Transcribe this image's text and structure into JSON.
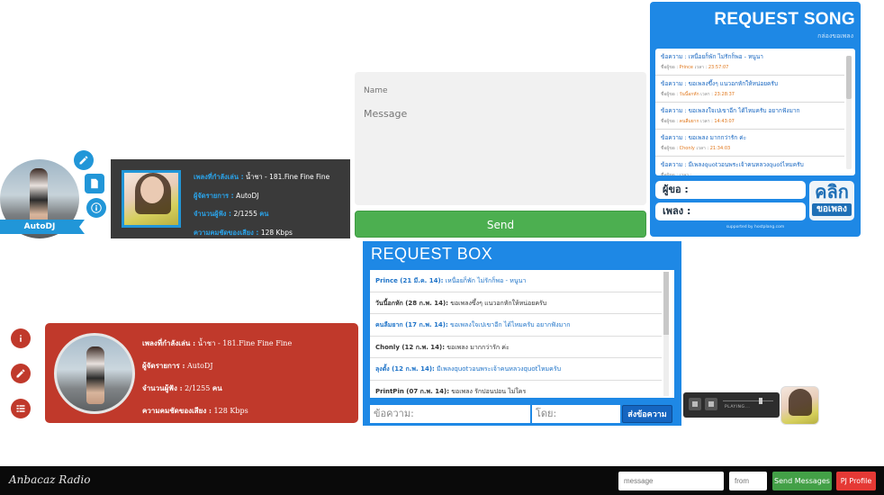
{
  "profile1": {
    "dj_name": "AutoDJ",
    "now_playing_label": "เพลงที่กำลังเล่น :",
    "now_playing_value": "น้ำชา - 181.Fine Fine Fine",
    "manager_label": "ผู้จัดรายการ :",
    "manager_value": "AutoDJ",
    "listeners_label": "จำนวนผู้ฟัง :",
    "listeners_value": "2/1255",
    "listeners_unit": "คน",
    "bitrate_label": "ความคมชัดของเสียง :",
    "bitrate_value": "128 Kbps"
  },
  "form": {
    "name_placeholder": "Name",
    "message_placeholder": "Message",
    "send_label": "Send"
  },
  "request_song": {
    "title": "REQUEST SONG",
    "subtitle": "กล่องขอเพลง",
    "name_prefix": "ชื่อผู้ขอ :",
    "time_prefix": "เวลา :",
    "items": [
      {
        "message": "ข้อความ : เหนื่อยก็พัก ไม่รักก็พอ - หนูนา",
        "name": "Prince",
        "time": "23:57:07"
      },
      {
        "message": "ข้อความ : ขอเพลงขึ้งๆ แนวอกหักให้หน่อยครับ",
        "name": "วันนี้อกหัก",
        "time": "23:28:37"
      },
      {
        "message": "ข้อความ : ขอเพลงใจเปเขาอีก ได้ไหมครับ อยากฟังมาก",
        "name": "คนลืมยาก",
        "time": "14:43:07"
      },
      {
        "message": "ข้อความ : ขอเพลง มากกว่ารัก ค่ะ",
        "name": "Chonly",
        "time": "21:34:03"
      },
      {
        "message": "ข้อความ : มีเพลงquotวอนพระเจ้าคนหลวงquotไหมครับ",
        "name": "",
        "time": ""
      }
    ],
    "requester_label": "ผู้ขอ :",
    "song_label": "เพลง :",
    "click_big": "คลิก",
    "click_small": "ขอเพลง",
    "footer": "supported by hostplang.com"
  },
  "request_box": {
    "title": "REQUEST BOX",
    "items": [
      {
        "who": "Prince (21 มี.ค. 14):",
        "text": " เหนื่อยก็พัก ไม่รักก็พอ - หนูนา",
        "style": "blue"
      },
      {
        "who": "วันนี้อกหัก (28 ก.พ. 14):",
        "text": " ขอเพลงขึ้งๆ แนวอกหักให้หน่อยครับ",
        "style": "dark"
      },
      {
        "who": "คนลืมยาก (17 ก.พ. 14):",
        "text": " ขอเพลงใจเปเขาอีก ได้ไหมครับ อยากฟังมาก",
        "style": "blue"
      },
      {
        "who": "Chonly (12 ก.พ. 14):",
        "text": " ขอเพลง มากกว่ารัก ค่ะ",
        "style": "dark"
      },
      {
        "who": "ลุงตั้ง (12 ก.พ. 14):",
        "text": " มีเพลงquotวอนพระเจ้าคนหลวงquotไหมครับ",
        "style": "blue"
      },
      {
        "who": "PrintPin (07 ก.พ. 14):",
        "text": " ขอเพลง รักปอนปอน ไม่ใคร",
        "style": "dark"
      }
    ],
    "message_placeholder": "ข้อความ:",
    "from_placeholder": "โดย:",
    "send_label": "ส่งข้อความ"
  },
  "profile2": {
    "now_playing_label": "เพลงที่กำลังเล่น :",
    "now_playing_value": "น้ำชา - 181.Fine Fine Fine",
    "manager_label": "ผู้จัดรายการ :",
    "manager_value": "AutoDJ",
    "listeners_label": "จำนวนผู้ฟัง :",
    "listeners_value": "2/1255",
    "listeners_unit": "คน",
    "bitrate_label": "ความคมชัดของเสียง :",
    "bitrate_value": "128 Kbps"
  },
  "player": {
    "status": "PLAYING..."
  },
  "bottombar": {
    "brand": "Anbacaz Radio",
    "message_placeholder": "message",
    "from_placeholder": "from",
    "send_label": "Send Messages",
    "profile_label": "PJ Profile"
  },
  "colors": {
    "accent_blue": "#1e88e5",
    "send_green": "#4caf50",
    "panel_red": "#c0392b",
    "profile_red": "#e53935",
    "send_messages_green": "#43a047"
  }
}
